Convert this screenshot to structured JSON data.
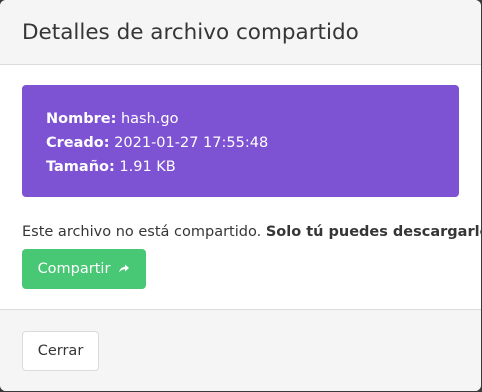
{
  "modal": {
    "title": "Detalles de archivo compartido"
  },
  "file_info": {
    "name_label": "Nombre:",
    "name_value": "hash.go",
    "created_label": "Creado:",
    "created_value": "2021-01-27 17:55:48",
    "size_label": "Tamaño:",
    "size_value": "1.91 KB"
  },
  "share": {
    "status_text": "Este archivo no está compartido.",
    "status_bold": "Solo tú puedes descargarlo",
    "button_label": "Compartir",
    "button_icon": "share-arrow-icon"
  },
  "footer": {
    "close_label": "Cerrar"
  },
  "colors": {
    "info_box": "#7d52d3",
    "share_button": "#48c774",
    "header_footer_bg": "#f5f5f5"
  }
}
